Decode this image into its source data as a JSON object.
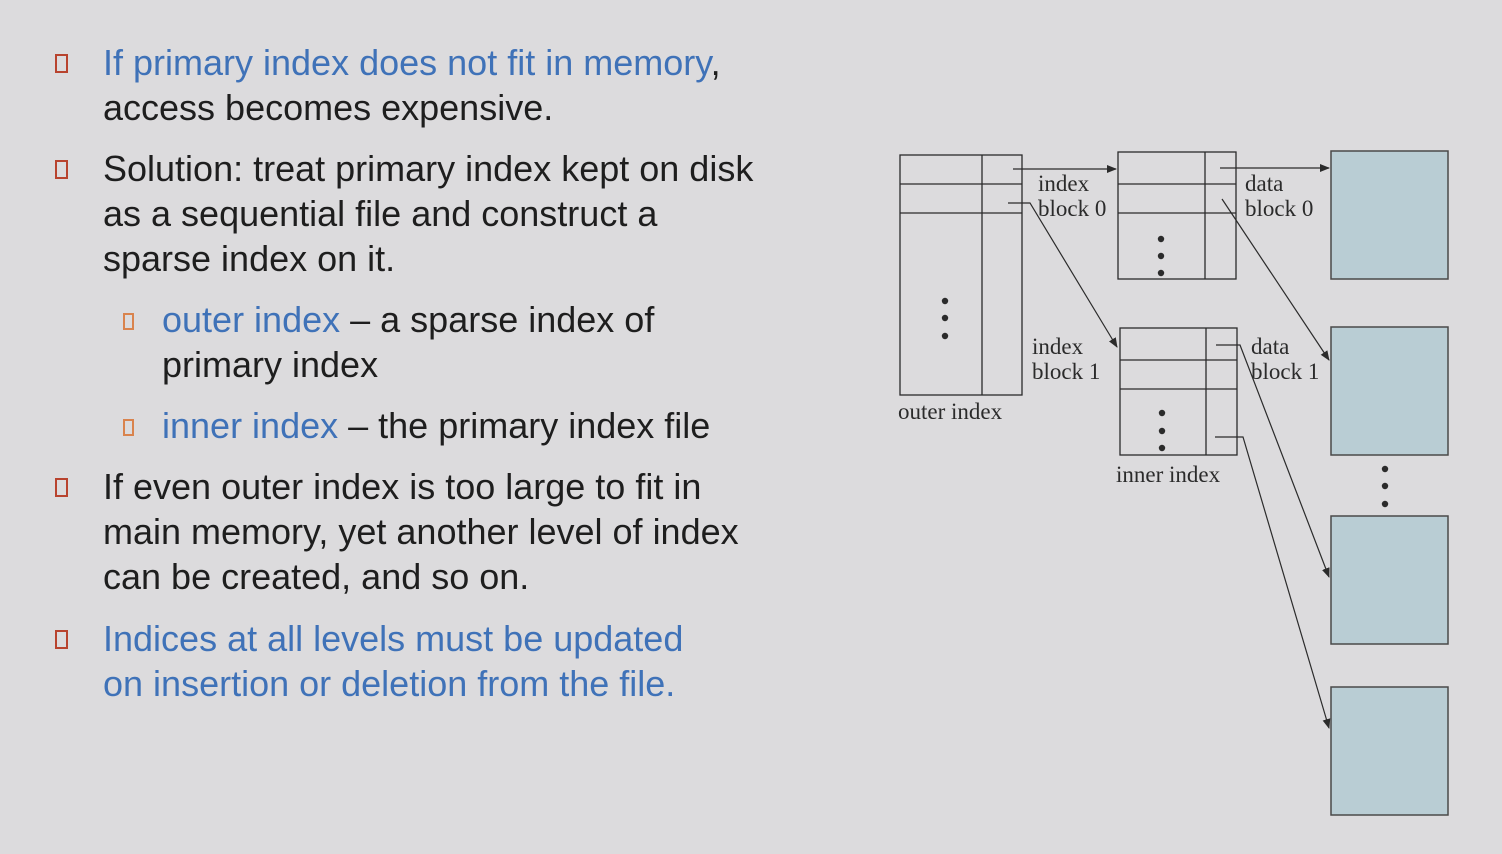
{
  "bullets": [
    {
      "highlight": "If primary index does not fit in memory",
      "rest": ", access becomes expensive."
    },
    {
      "text": "Solution: treat primary index kept on disk as a sequential file and construct a sparse index on it."
    },
    {
      "highlight": "outer index",
      "rest": " – a sparse index of primary index"
    },
    {
      "highlight": "inner index",
      "rest": " – the primary index file"
    },
    {
      "text": "If even outer index is too large to fit in main memory, yet another level of index can be created, and so on."
    },
    {
      "highlight": "Indices at all levels must be updated on insertion or deletion from the file."
    }
  ],
  "diagram": {
    "outer_index_label": "outer index",
    "inner_index_label": "inner index",
    "index_block_0": [
      "index",
      "block 0"
    ],
    "index_block_1": [
      "index",
      "block 1"
    ],
    "data_block_0": [
      "data",
      "block 0"
    ],
    "data_block_1": [
      "data",
      "block 1"
    ],
    "data_block_color": "#b9cdd4",
    "colors": {
      "accent_blue": "#3f72b8",
      "marker_red": "#b8432e",
      "marker_orange": "#d9834d"
    }
  }
}
